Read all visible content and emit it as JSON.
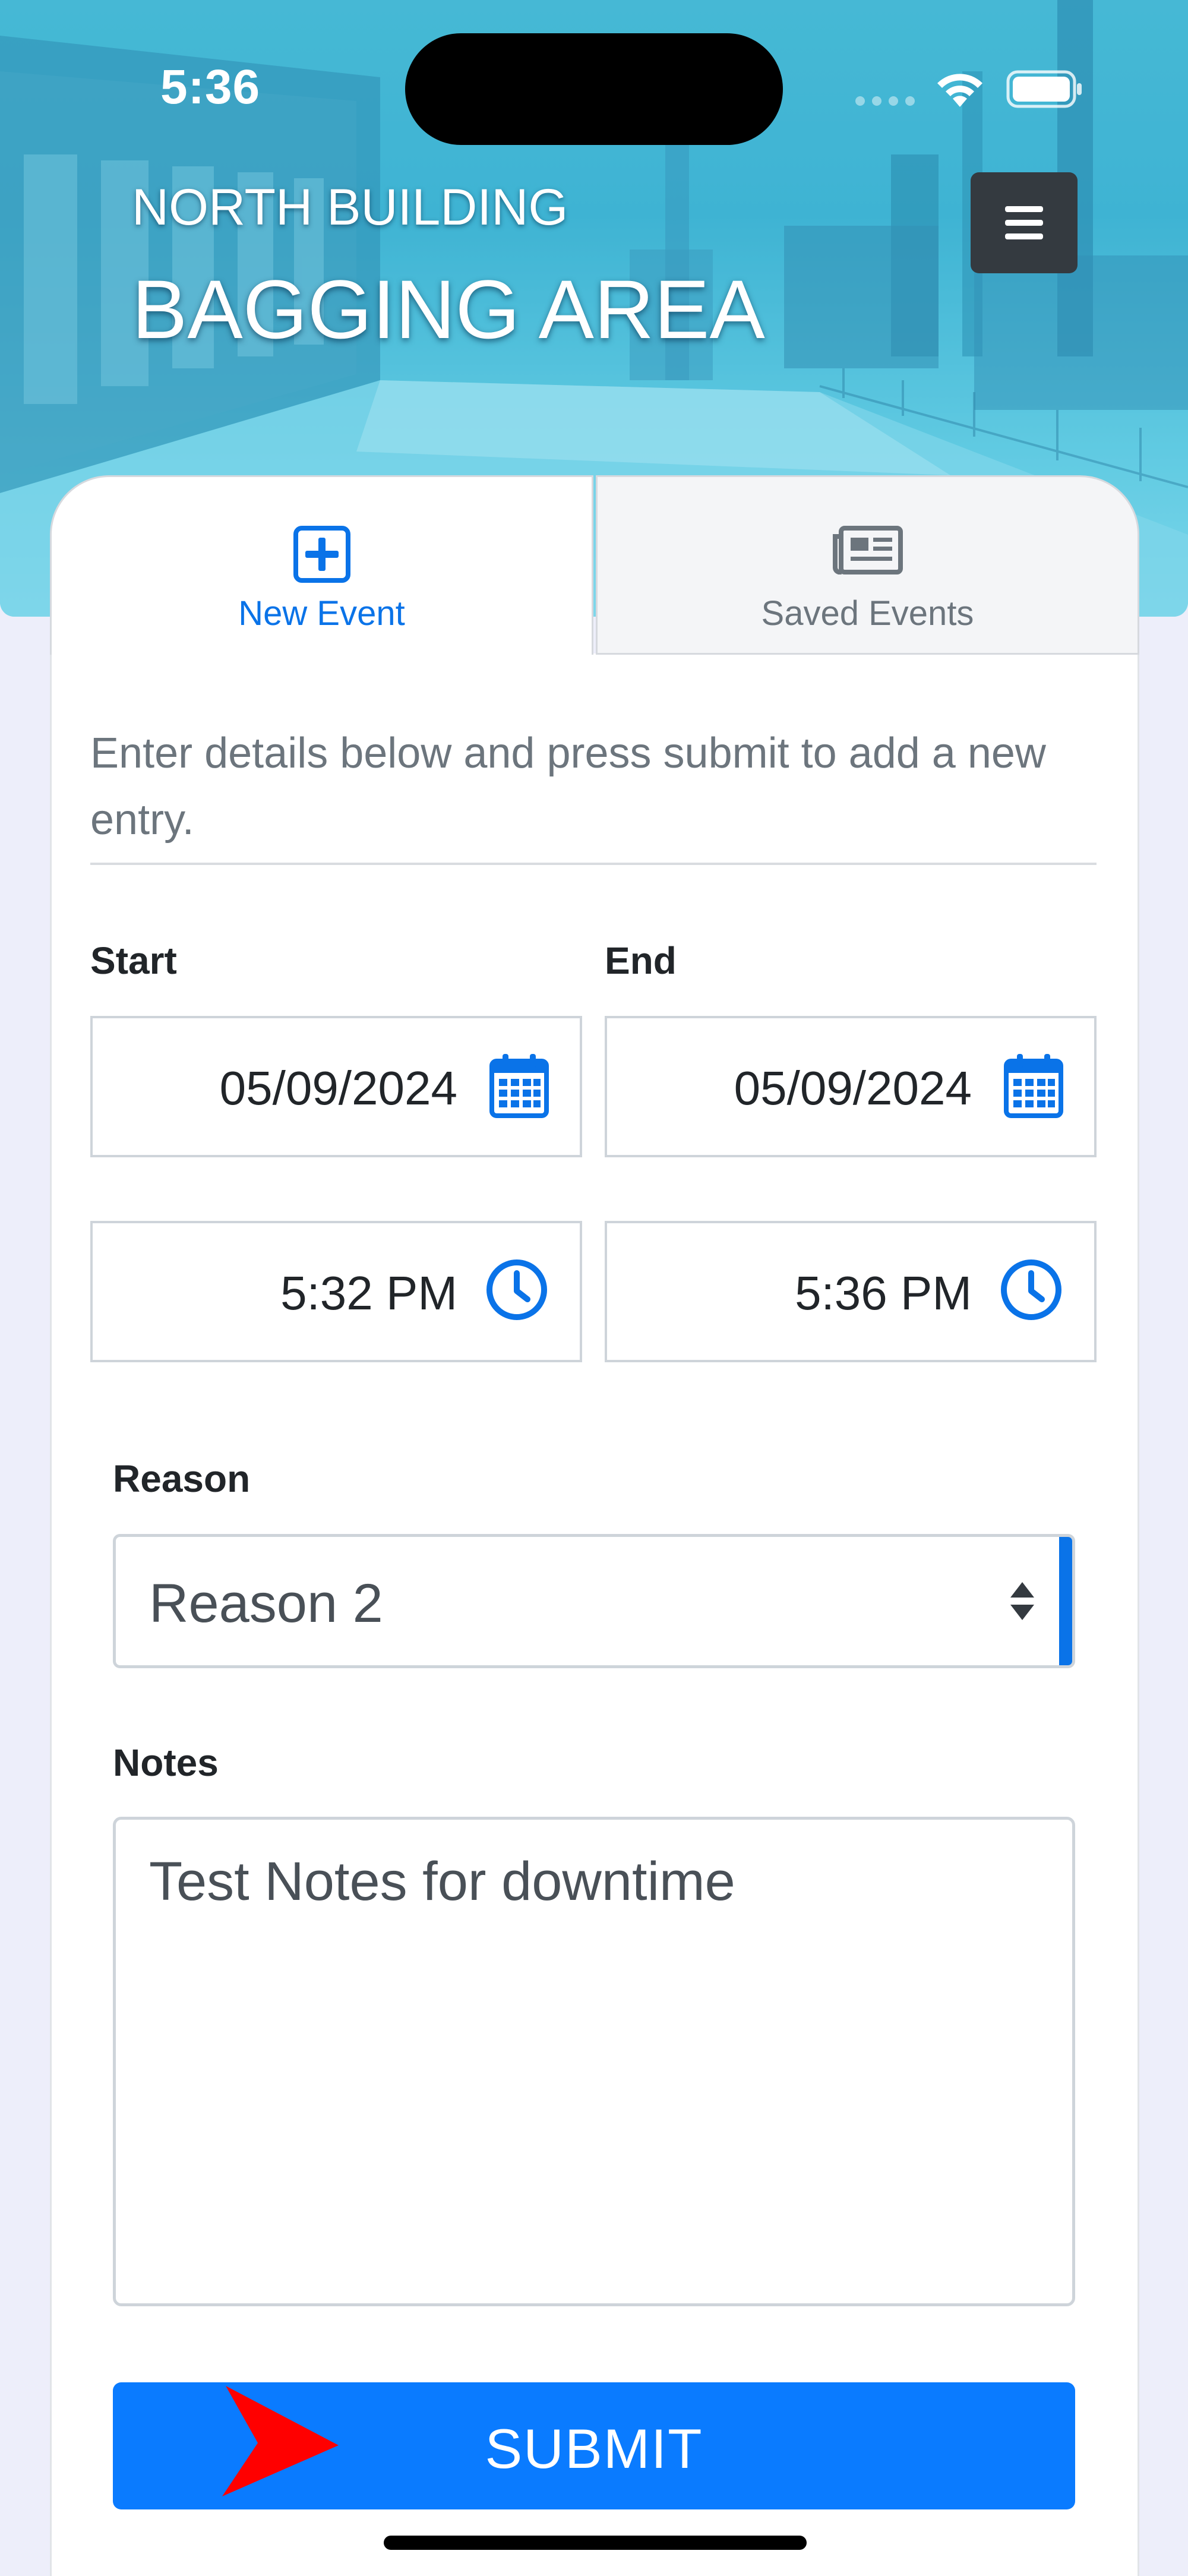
{
  "status_bar": {
    "time": "5:36"
  },
  "header": {
    "subtitle": "NORTH BUILDING",
    "title": "BAGGING AREA",
    "menu_icon": "hamburger-menu-icon"
  },
  "tabs": [
    {
      "label": "New Event",
      "icon": "plus-square-icon",
      "active": true
    },
    {
      "label": "Saved Events",
      "icon": "newspaper-icon",
      "active": false
    }
  ],
  "form": {
    "intro": "Enter details below and press submit to add a new entry.",
    "start_label": "Start",
    "end_label": "End",
    "start_date": "05/09/2024",
    "end_date": "05/09/2024",
    "start_time": "5:32 PM",
    "end_time": "5:36 PM",
    "reason_label": "Reason",
    "reason_value": "Reason 2",
    "notes_label": "Notes",
    "notes_value": "Test Notes for downtime",
    "submit_label": "SUBMIT"
  },
  "colors": {
    "accent": "#0a7bff",
    "header": "#3db2d3",
    "menu_button": "#343a40",
    "pointer": "#ff0000"
  }
}
